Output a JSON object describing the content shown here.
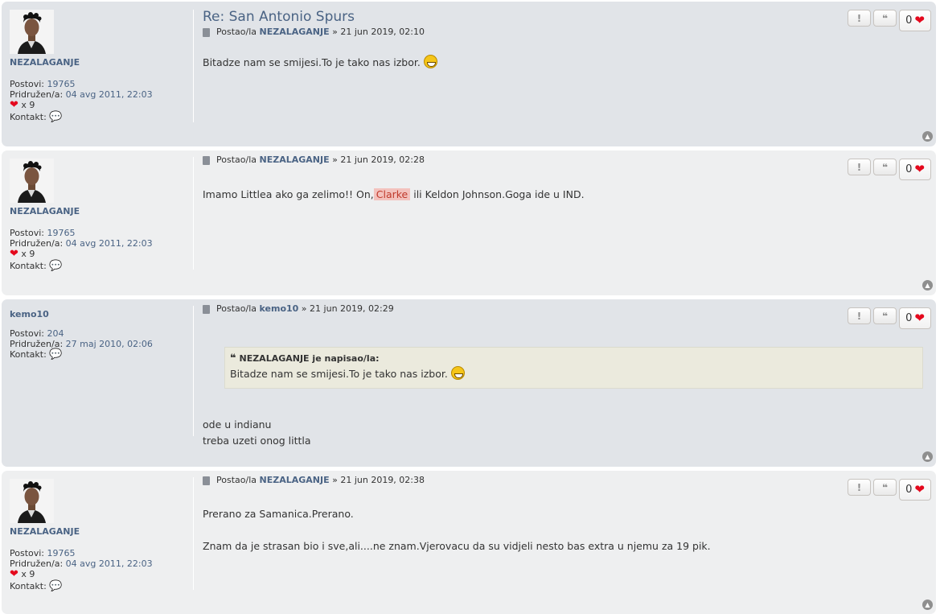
{
  "topic_title": "Re: San Antonio Spurs",
  "labels": {
    "posted_by": "Postao/la",
    "posts": "Postovi:",
    "joined": "Pridružen/a:",
    "contact": "Kontakt:",
    "likes_prefix": "x",
    "wrote": "je napisao/la:",
    "report": "!",
    "quote": "❝"
  },
  "posts": [
    {
      "author": "NEZALAGANJE",
      "posts": "19765",
      "joined": "04 avg 2011, 22:03",
      "likes_received": "9",
      "date": "21 jun 2019, 02:10",
      "like_count": "0",
      "content": "Bitadze nam se smijesi.To je tako nas izbor."
    },
    {
      "author": "NEZALAGANJE",
      "posts": "19765",
      "joined": "04 avg 2011, 22:03",
      "likes_received": "9",
      "date": "21 jun 2019, 02:28",
      "like_count": "0",
      "content_before": "Imamo Littlea ako ga zelimo!! On,",
      "content_highlight": "Clarke",
      "content_after": " ili Keldon Johnson.Goga ide u IND."
    },
    {
      "author": "kemo10",
      "posts": "204",
      "joined": "27 maj 2010, 02:06",
      "date": "21 jun 2019, 02:29",
      "like_count": "0",
      "quote_author": "NEZALAGANJE",
      "quote_text": "Bitadze nam se smijesi.To je tako nas izbor.",
      "content_line1": "ode u indianu",
      "content_line2": "treba uzeti onog littla"
    },
    {
      "author": "NEZALAGANJE",
      "posts": "19765",
      "joined": "04 avg 2011, 22:03",
      "likes_received": "9",
      "date": "21 jun 2019, 02:38",
      "like_count": "0",
      "content_line1": "Prerano za Samanica.Prerano.",
      "content_line2": "Znam da je strasan bio i sve,ali....ne znam.Vjerovacu da su vidjeli nesto bas extra u njemu za 19 pik."
    }
  ],
  "colors": {
    "link": "#4a6384",
    "bg_alt1": "#e1e4e8",
    "bg_alt2": "#eeeff0",
    "heart": "#e4081d"
  }
}
